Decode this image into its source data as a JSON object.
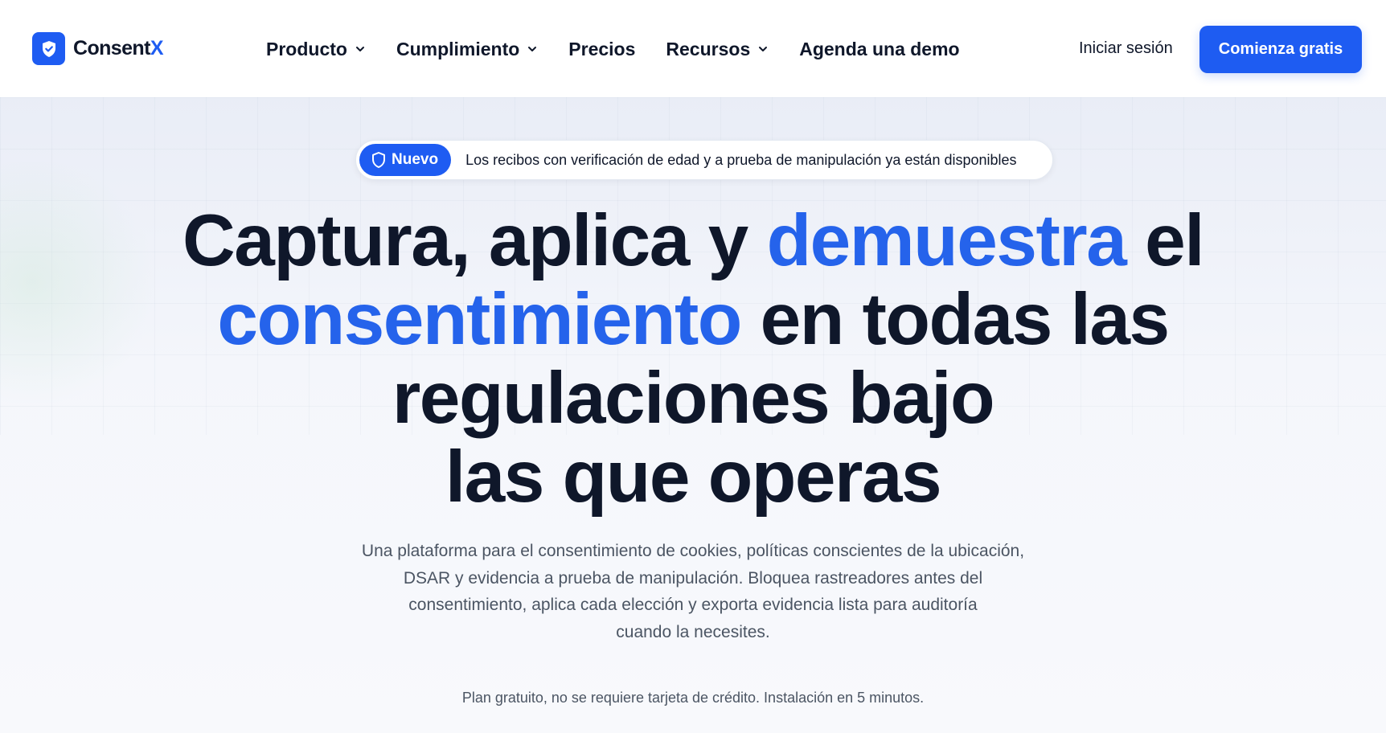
{
  "brand": {
    "name_main": "Consent",
    "name_accent": "X",
    "logo_icon": "shield-check-icon",
    "accent_color": "#1e5cf2"
  },
  "nav": {
    "items": [
      {
        "label": "Producto",
        "has_dropdown": true
      },
      {
        "label": "Cumplimiento",
        "has_dropdown": true
      },
      {
        "label": "Precios",
        "has_dropdown": false
      },
      {
        "label": "Recursos",
        "has_dropdown": true
      },
      {
        "label": "Agenda una demo",
        "has_dropdown": false
      }
    ],
    "login_label": "Iniciar sesión",
    "cta_label": "Comienza gratis"
  },
  "announcement": {
    "badge_label": "Nuevo",
    "badge_icon": "shield-icon",
    "text": "Los recibos con verificación de edad y a prueba de manipulación ya están disponibles"
  },
  "hero": {
    "headline_part1": "Captura, aplica y ",
    "headline_highlight1": "demuestra",
    "headline_part2": " el",
    "headline_highlight2": "consentimiento",
    "headline_part3": " en todas las",
    "headline_line3": "regulaciones bajo",
    "headline_line4": "las que operas",
    "highlight_color": "#2563eb",
    "subtitle_line1": "Una plataforma para el consentimiento de cookies, políticas conscientes de la ubicación,",
    "subtitle_line2": "DSAR y evidencia a prueba de manipulación. Bloquea rastreadores antes del",
    "subtitle_line3": "consentimiento, aplica cada elección y exporta evidencia lista para auditoría",
    "subtitle_line4": "cuando la necesites.",
    "note": "Plan gratuito, no se requiere tarjeta de crédito. Instalación en 5 minutos."
  }
}
